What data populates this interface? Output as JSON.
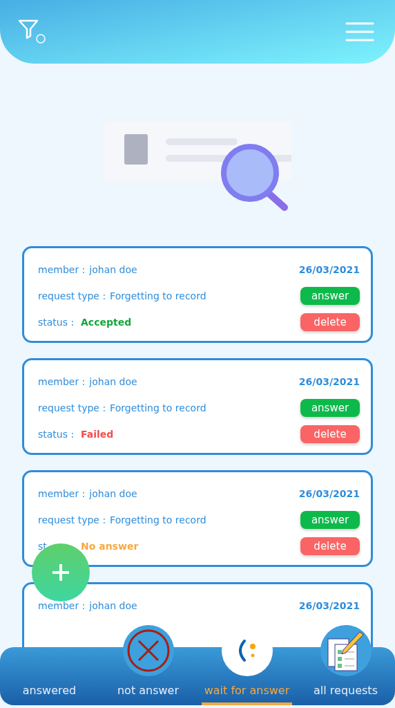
{
  "cards": [
    {
      "member_label": "member :",
      "member": "johan doe",
      "date": "26/03/2021",
      "type_label": "request type :",
      "type": "Forgetting to record",
      "status_label": "status :",
      "status": "Accepted",
      "color": "#13a83e",
      "actions": [
        "answer",
        "delete"
      ]
    },
    {
      "member_label": "member :",
      "member": "johan doe",
      "date": "26/03/2021",
      "type_label": "request type :",
      "type": "Forgetting to record",
      "status_label": "status :",
      "status": "Failed",
      "color": "#f24e4e",
      "actions": [
        "answer",
        "delete"
      ]
    },
    {
      "member_label": "member :",
      "member": "johan doe",
      "date": "26/03/2021",
      "type_label": "request type :",
      "type": "Forgetting to record",
      "status_label": "st",
      "status": "No answer",
      "color": "#f5a941",
      "actions": [
        "answer",
        "delete"
      ]
    },
    {
      "member_label": "member :",
      "member": "johan doe",
      "date": "26/03/2021"
    }
  ],
  "tabs": [
    {
      "label": "answered",
      "selected": false
    },
    {
      "label": "not answer",
      "selected": false
    },
    {
      "label": "wait for answer",
      "selected": true
    },
    {
      "label": "all requests",
      "selected": false
    }
  ]
}
